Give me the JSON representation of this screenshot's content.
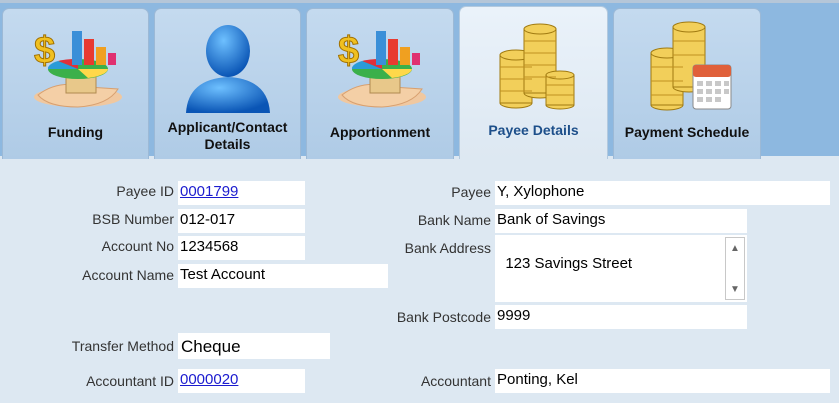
{
  "tabs": [
    {
      "id": "funding",
      "label": "Funding",
      "icon": "money-pie-chart-icon"
    },
    {
      "id": "applicant",
      "label_line1": "Applicant/Contact",
      "label_line2": "Details",
      "icon": "person-icon"
    },
    {
      "id": "apportionment",
      "label": "Apportionment",
      "icon": "money-pie-chart-icon"
    },
    {
      "id": "payee",
      "label": "Payee Details",
      "icon": "coin-stacks-icon",
      "active": true
    },
    {
      "id": "schedule",
      "label": "Payment Schedule",
      "icon": "coins-calendar-icon"
    }
  ],
  "form": {
    "payee_id": {
      "label": "Payee ID",
      "value": "0001799"
    },
    "bsb": {
      "label": "BSB Number",
      "value": "012-017"
    },
    "account_no": {
      "label": "Account No",
      "value": "1234568"
    },
    "account_name": {
      "label": "Account Name",
      "value": "Test Account"
    },
    "transfer_method": {
      "label": "Transfer Method",
      "value": "Cheque"
    },
    "accountant_id": {
      "label": "Accountant ID",
      "value": "0000020"
    },
    "payee": {
      "label": "Payee",
      "value": "Y, Xylophone"
    },
    "bank_name": {
      "label": "Bank Name",
      "value": "Bank of Savings"
    },
    "bank_address": {
      "label": "Bank Address",
      "value": "123 Savings Street"
    },
    "bank_postcode": {
      "label": "Bank Postcode",
      "value": "9999"
    },
    "accountant": {
      "label": "Accountant",
      "value": "Ponting, Kel"
    }
  },
  "colors": {
    "accent": "#1d4f8a",
    "link": "#1b1bcf",
    "background": "#dde8f2"
  }
}
